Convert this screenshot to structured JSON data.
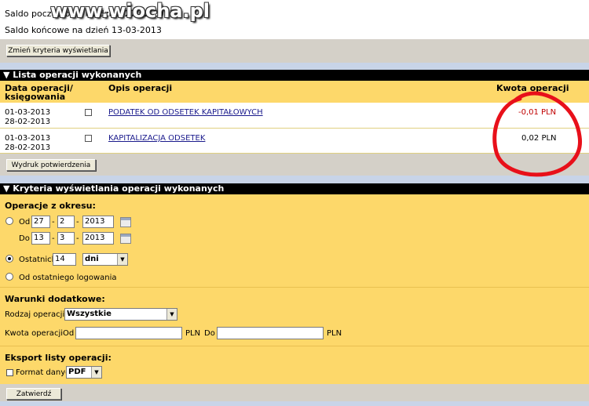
{
  "watermark": "www.wiocha.pl",
  "saldo": {
    "start": "Saldo początkowe na dzień 27-02-2013",
    "end": "Saldo końcowe na dzień 13-03-2013"
  },
  "buttons": {
    "change_criteria": "Zmień kryteria wyświetlania",
    "print_confirmation": "Wydruk potwierdzenia",
    "submit": "Zatwierdź"
  },
  "operations": {
    "title": "▼ Lista operacji wykonanych",
    "columns": {
      "date": "Data operacji/",
      "date2": "księgowania",
      "desc": "Opis operacji",
      "amount": "Kwota operacji"
    },
    "rows": [
      {
        "date_op": "01-03-2013",
        "date_book": "28-02-2013",
        "desc": "PODATEK OD ODSETEK KAPITAŁOWYCH",
        "amount": "-0,01 PLN",
        "amount_color": "#c00000"
      },
      {
        "date_op": "01-03-2013",
        "date_book": "28-02-2013",
        "desc": "KAPITALIZACJA ODSETEK",
        "amount": "0,02 PLN",
        "amount_color": "#000000"
      }
    ]
  },
  "criteria": {
    "title": "▼ Kryteria wyświetlania operacji wykonanych",
    "period_label": "Operacje z okresu:",
    "from_label": "Od",
    "to_label": "Do",
    "from": {
      "day": "27",
      "month": "2",
      "year": "2013"
    },
    "to": {
      "day": "13",
      "month": "3",
      "year": "2013"
    },
    "dash": "-",
    "last_label": "Ostatnich",
    "last_value": "14",
    "last_unit": "dni",
    "since_login": "Od ostatniego logowania",
    "extra_label": "Warunki dodatkowe:",
    "type_label": "Rodzaj operacji",
    "type_value": "Wszystkie",
    "amount_label": "Kwota operacji",
    "amount_from": "Od",
    "amount_to": "Do",
    "currency": "PLN",
    "export_label": "Eksport listy operacji:",
    "format_label": "Format danych",
    "format_value": "PDF"
  },
  "colors": {
    "highlight_circle": "#e8101a",
    "panel": "#fdd86a"
  }
}
